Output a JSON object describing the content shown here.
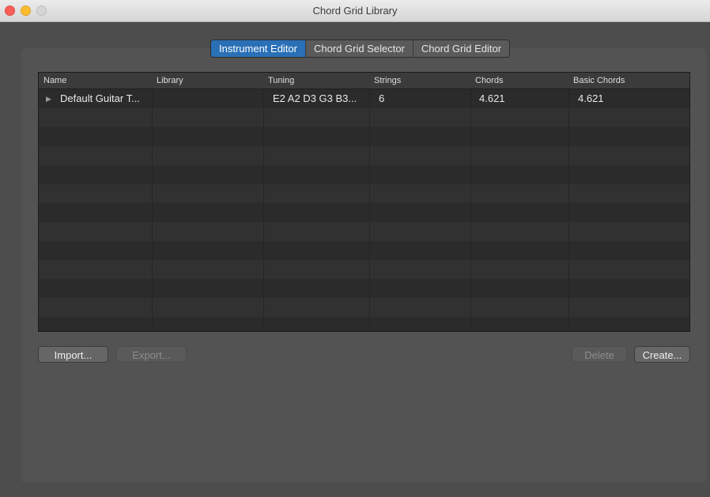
{
  "window": {
    "title": "Chord Grid Library"
  },
  "tabs": [
    {
      "label": "Instrument Editor",
      "selected": true
    },
    {
      "label": "Chord Grid Selector",
      "selected": false
    },
    {
      "label": "Chord Grid Editor",
      "selected": false
    }
  ],
  "table": {
    "columns": [
      "Name",
      "Library",
      "Tuning",
      "Strings",
      "Chords",
      "Basic Chords"
    ],
    "rows": [
      {
        "name": "Default Guitar T...",
        "library": "",
        "tuning": "E2 A2 D3 G3 B3...",
        "strings": "6",
        "chords": "4.621",
        "basic_chords": "4.621"
      }
    ]
  },
  "buttons": {
    "import": "Import...",
    "export": "Export...",
    "delete": "Delete",
    "create": "Create..."
  },
  "icons": {
    "disclosure": "disclosure-triangle-right"
  },
  "colors": {
    "accent": "#2a70b7"
  }
}
